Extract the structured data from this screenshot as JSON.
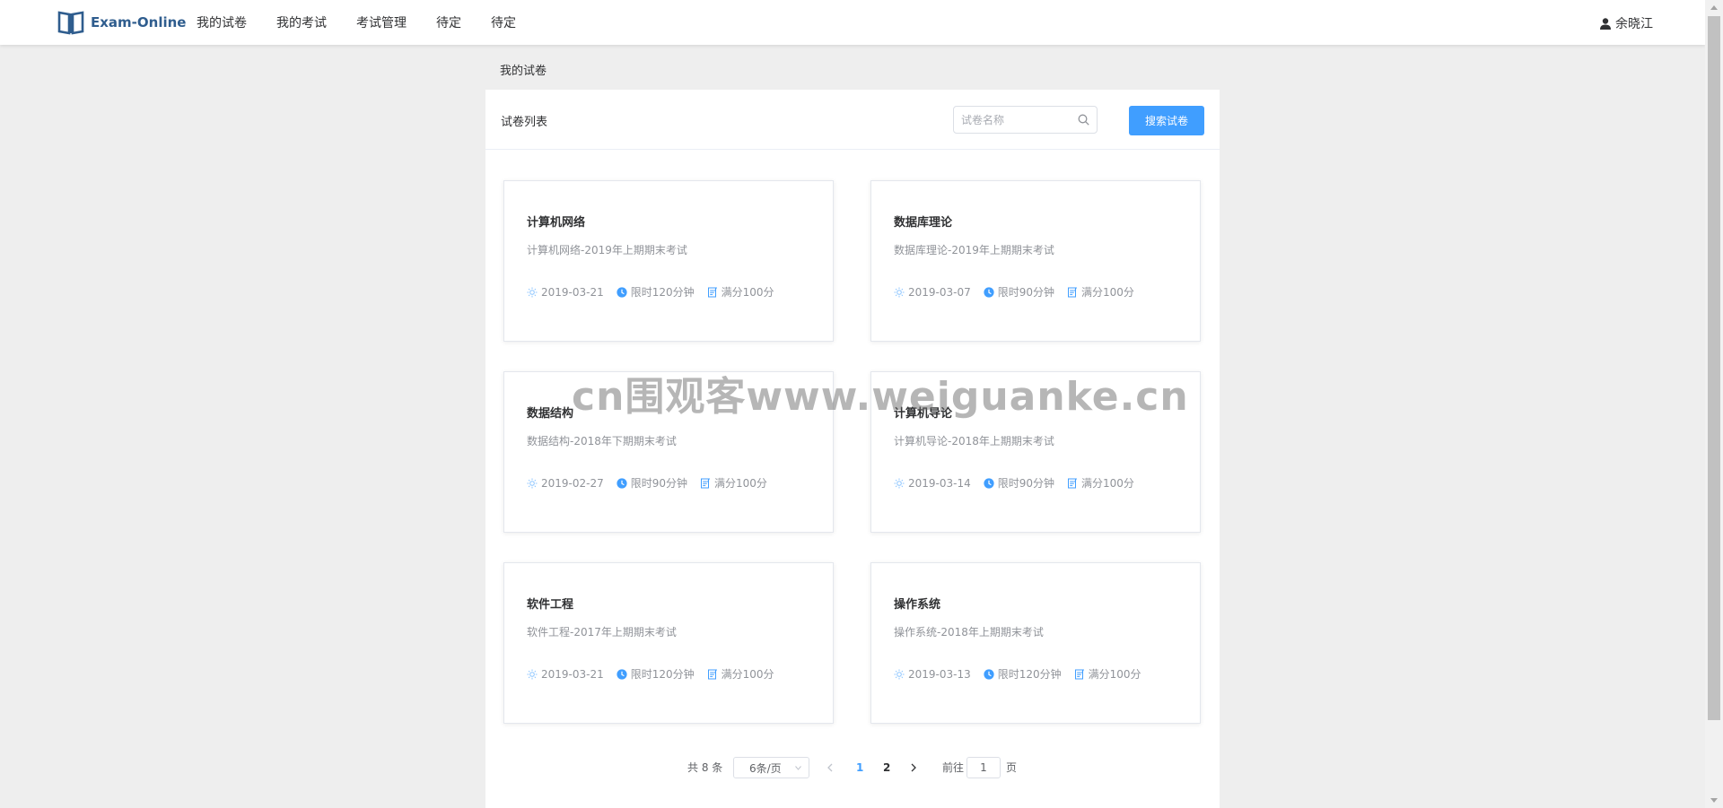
{
  "header": {
    "logo_text": "Exam-Online",
    "nav": [
      "我的试卷",
      "我的考试",
      "考试管理",
      "待定",
      "待定"
    ],
    "user_name": "余晓江"
  },
  "breadcrumb": "我的试卷",
  "panel": {
    "title": "试卷列表",
    "search_placeholder": "试卷名称",
    "search_button": "搜索试卷"
  },
  "papers": [
    {
      "title": "计算机网络",
      "desc": "计算机网络-2019年上期期末考试",
      "date": "2019-03-21",
      "duration": "限时120分钟",
      "score": "满分100分"
    },
    {
      "title": "数据库理论",
      "desc": "数据库理论-2019年上期期末考试",
      "date": "2019-03-07",
      "duration": "限时90分钟",
      "score": "满分100分"
    },
    {
      "title": "数据结构",
      "desc": "数据结构-2018年下期期末考试",
      "date": "2019-02-27",
      "duration": "限时90分钟",
      "score": "满分100分"
    },
    {
      "title": "计算机导论",
      "desc": "计算机导论-2018年上期期末考试",
      "date": "2019-03-14",
      "duration": "限时90分钟",
      "score": "满分100分"
    },
    {
      "title": "软件工程",
      "desc": "软件工程-2017年上期期末考试",
      "date": "2019-03-21",
      "duration": "限时120分钟",
      "score": "满分100分"
    },
    {
      "title": "操作系统",
      "desc": "操作系统-2018年上期期末考试",
      "date": "2019-03-13",
      "duration": "限时120分钟",
      "score": "满分100分"
    }
  ],
  "pagination": {
    "total_text": "共 8 条",
    "page_size": "6条/页",
    "pages": [
      "1",
      "2"
    ],
    "current_page": "1",
    "goto_label": "前往",
    "goto_value": "1",
    "page_suffix": "页"
  },
  "watermark": "cn围观客www.weiguanke.cn",
  "colors": {
    "accent": "#409eff",
    "brand": "#2f5d8e",
    "background": "#eeeeee"
  }
}
